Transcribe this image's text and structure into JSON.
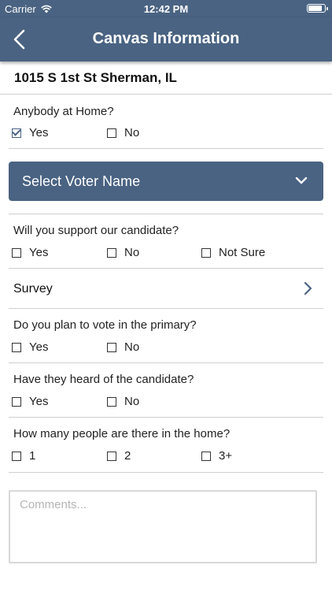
{
  "status_bar": {
    "carrier": "Carrier",
    "time": "12:42 PM"
  },
  "nav": {
    "title": "Canvas Information",
    "back_icon": "chevron-left-icon"
  },
  "address": "1015 S 1st St Sherman, IL",
  "anybody_home": {
    "question": "Anybody at Home?",
    "options": [
      {
        "label": "Yes",
        "checked": true
      },
      {
        "label": "No",
        "checked": false
      }
    ]
  },
  "voter_select": {
    "label": "Select Voter Name",
    "icon": "chevron-down-icon"
  },
  "support": {
    "question": "Will you support our candidate?",
    "options": [
      {
        "label": "Yes",
        "checked": false
      },
      {
        "label": "No",
        "checked": false
      },
      {
        "label": "Not Sure",
        "checked": false
      }
    ]
  },
  "survey": {
    "label": "Survey",
    "icon": "chevron-right-icon"
  },
  "primary": {
    "question": "Do you plan to vote in the primary?",
    "options": [
      {
        "label": "Yes",
        "checked": false
      },
      {
        "label": "No",
        "checked": false
      }
    ]
  },
  "heard": {
    "question": "Have they heard of the candidate?",
    "options": [
      {
        "label": "Yes",
        "checked": false
      },
      {
        "label": "No",
        "checked": false
      }
    ]
  },
  "people": {
    "question": "How many people are there in the home?",
    "options": [
      {
        "label": "1",
        "checked": false
      },
      {
        "label": "2",
        "checked": false
      },
      {
        "label": "3+",
        "checked": false
      }
    ]
  },
  "comments": {
    "placeholder": "Comments...",
    "value": ""
  },
  "colors": {
    "primary": "#4a6382",
    "divider": "#cfcfcf"
  }
}
